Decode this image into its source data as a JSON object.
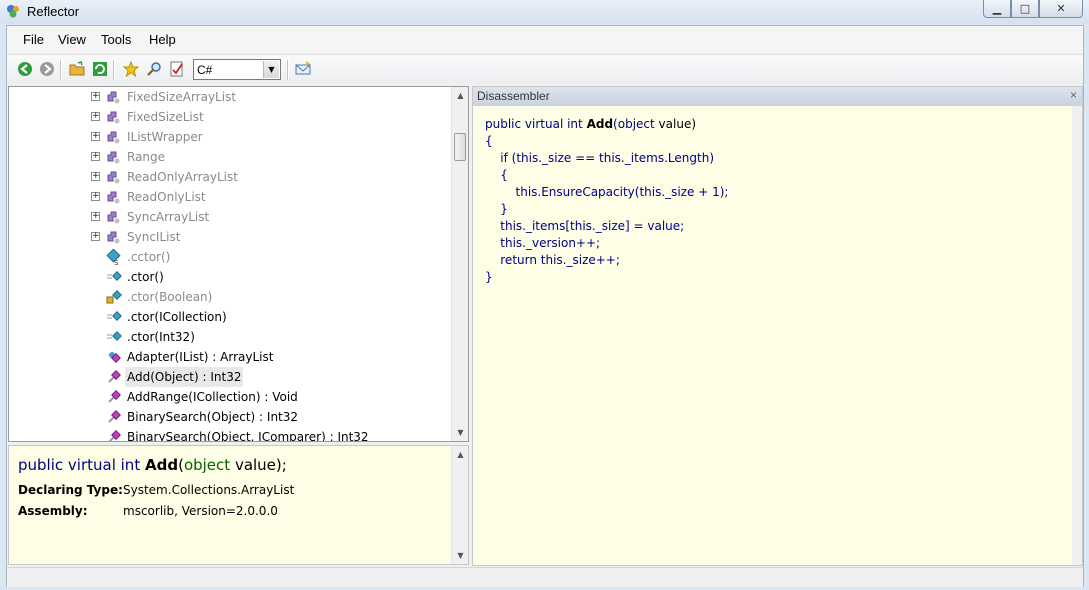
{
  "window": {
    "title": "Reflector"
  },
  "menu": [
    "File",
    "View",
    "Tools",
    "Help"
  ],
  "toolbar": {
    "language": "C#",
    "buttons": [
      "back-icon",
      "forward-icon",
      "open-icon",
      "refresh-icon",
      "favorites-icon",
      "search-icon",
      "verify-icon",
      "send-icon"
    ]
  },
  "tree": {
    "items": [
      {
        "label": "FixedSizeArrayList",
        "kind": "class",
        "dim": true
      },
      {
        "label": "FixedSizeList",
        "kind": "class",
        "dim": true
      },
      {
        "label": "IListWrapper",
        "kind": "class",
        "dim": true
      },
      {
        "label": "Range",
        "kind": "class",
        "dim": true
      },
      {
        "label": "ReadOnlyArrayList",
        "kind": "class",
        "dim": true
      },
      {
        "label": "ReadOnlyList",
        "kind": "class",
        "dim": true
      },
      {
        "label": "SyncArrayList",
        "kind": "class",
        "dim": true
      },
      {
        "label": "SyncIList",
        "kind": "class",
        "dim": true
      },
      {
        "label": ".cctor()",
        "kind": "static-ctor",
        "dim": true
      },
      {
        "label": ".ctor()",
        "kind": "ctor",
        "dim": false
      },
      {
        "label": ".ctor(Boolean)",
        "kind": "internal-ctor",
        "dim": true
      },
      {
        "label": ".ctor(ICollection)",
        "kind": "ctor",
        "dim": false
      },
      {
        "label": ".ctor(Int32)",
        "kind": "ctor",
        "dim": false
      },
      {
        "label": "Adapter(IList) : ArrayList",
        "kind": "static-method",
        "dim": false
      },
      {
        "label": "Add(Object) : Int32",
        "kind": "method",
        "dim": false,
        "selected": true
      },
      {
        "label": "AddRange(ICollection) : Void",
        "kind": "method",
        "dim": false
      },
      {
        "label": "BinarySearch(Object) : Int32",
        "kind": "method",
        "dim": false
      },
      {
        "label": "BinarySearch(Object, IComparer) : Int32",
        "kind": "method",
        "dim": false
      }
    ]
  },
  "info": {
    "sig_kw1": "public virtual",
    "sig_kw2": "int",
    "sig_name": "Add",
    "sig_paren": "(",
    "sig_ptype": "object",
    "sig_rest": " value);",
    "declaring_label": "Declaring Type:",
    "declaring_value": "System.Collections.ArrayList",
    "assembly_label": "Assembly:",
    "assembly_value": "mscorlib, Version=2.0.0.0"
  },
  "disassembler": {
    "title": "Disassembler",
    "close": "×"
  },
  "colors": {
    "keyword": "#000080",
    "type": "#006400",
    "panel": "#fefee6"
  }
}
